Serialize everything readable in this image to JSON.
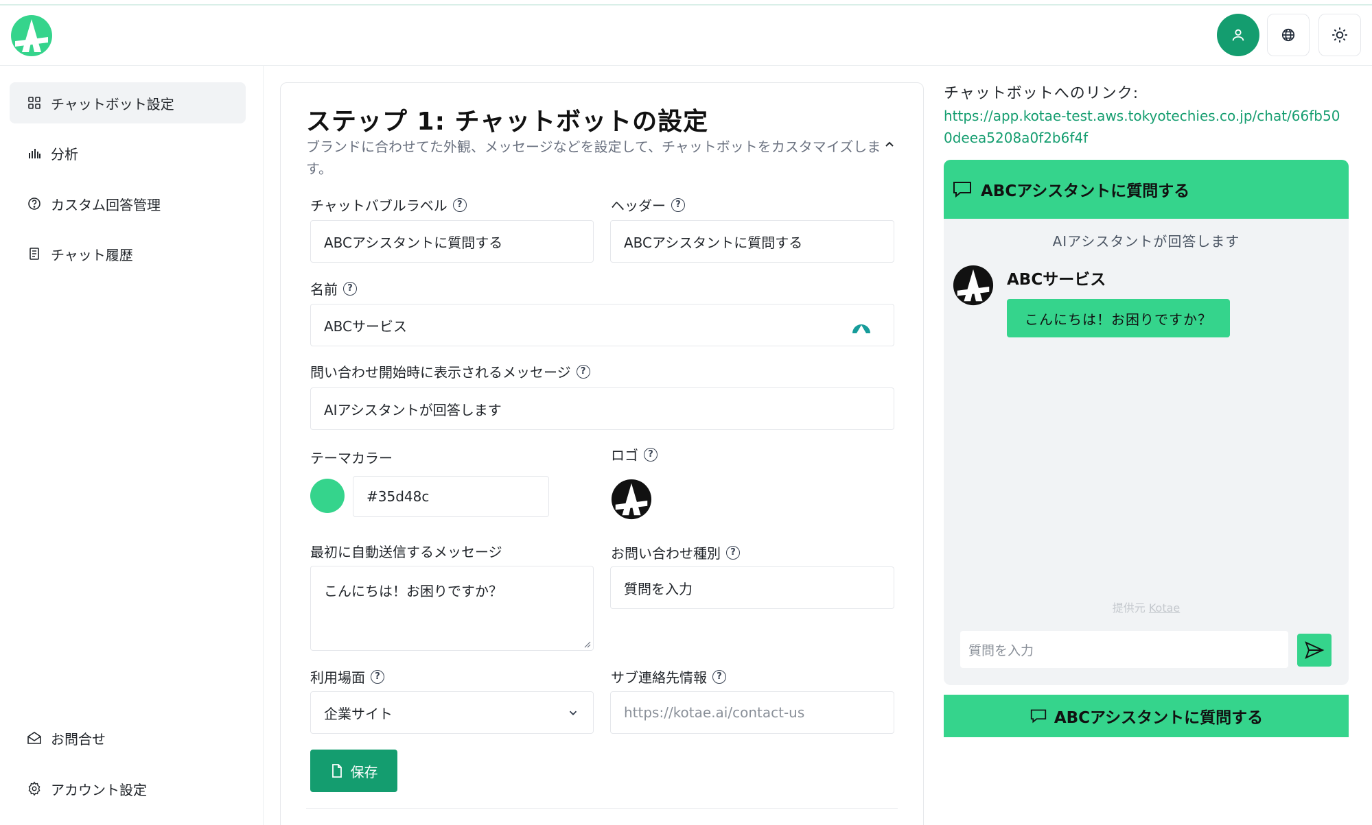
{
  "theme": {
    "accent": "#35d48c",
    "brand": "#149d6f"
  },
  "header": {
    "icons": [
      "app-logo",
      "user-icon",
      "globe-icon",
      "sun-icon"
    ]
  },
  "sidebar": {
    "items": [
      {
        "label": "チャットボット設定",
        "icon": "grid-icon",
        "active": true
      },
      {
        "label": "分析",
        "icon": "bar-chart-icon"
      },
      {
        "label": "カスタム回答管理",
        "icon": "help-circle-icon"
      },
      {
        "label": "チャット履歴",
        "icon": "document-icon"
      }
    ],
    "bottom": [
      {
        "label": "お問合せ",
        "icon": "mail-icon"
      },
      {
        "label": "アカウント設定",
        "icon": "gear-icon"
      }
    ]
  },
  "form": {
    "title": "ステップ 1: チャットボットの設定",
    "description": "ブランドに合わせてた外観、メッセージなどを設定して、チャットボットをカスタマイズします。",
    "bubble_label": {
      "label": "チャットバブルラベル",
      "value": "ABCアシスタントに質問する"
    },
    "header_field": {
      "label": "ヘッダー",
      "value": "ABCアシスタントに質問する"
    },
    "name": {
      "label": "名前",
      "value": "ABCサービス"
    },
    "start_message": {
      "label": "問い合わせ開始時に表示されるメッセージ",
      "value": "AIアシスタントが回答します"
    },
    "theme_color": {
      "label": "テーマカラー",
      "value": "#35d48c"
    },
    "logo": {
      "label": "ロゴ"
    },
    "auto_message": {
      "label": "最初に自動送信するメッセージ",
      "value": "こんにちは！お困りですか？"
    },
    "inquiry_type": {
      "label": "お問い合わせ種別",
      "value": "質問を入力"
    },
    "usage": {
      "label": "利用場面",
      "value": "企業サイト"
    },
    "sub_contact": {
      "label": "サブ連絡先情報",
      "placeholder": "https://kotae.ai/contact-us"
    },
    "save_label": "保存"
  },
  "preview": {
    "link_title": "チャットボットへのリンク:",
    "link_url": "https://app.kotae-test.aws.tokyotechies.co.jp/chat/66fb500deea5208a0f2b6f4f",
    "header": "ABCアシスタントに質問する",
    "subtitle": "AIアシスタントが回答します",
    "bot_name": "ABCサービス",
    "greeting": "こんにちは！お困りですか？",
    "powered_prefix": "提供元",
    "powered_brand": "Kotae",
    "input_placeholder": "質問を入力",
    "ask_button": "ABCアシスタントに質問する"
  }
}
